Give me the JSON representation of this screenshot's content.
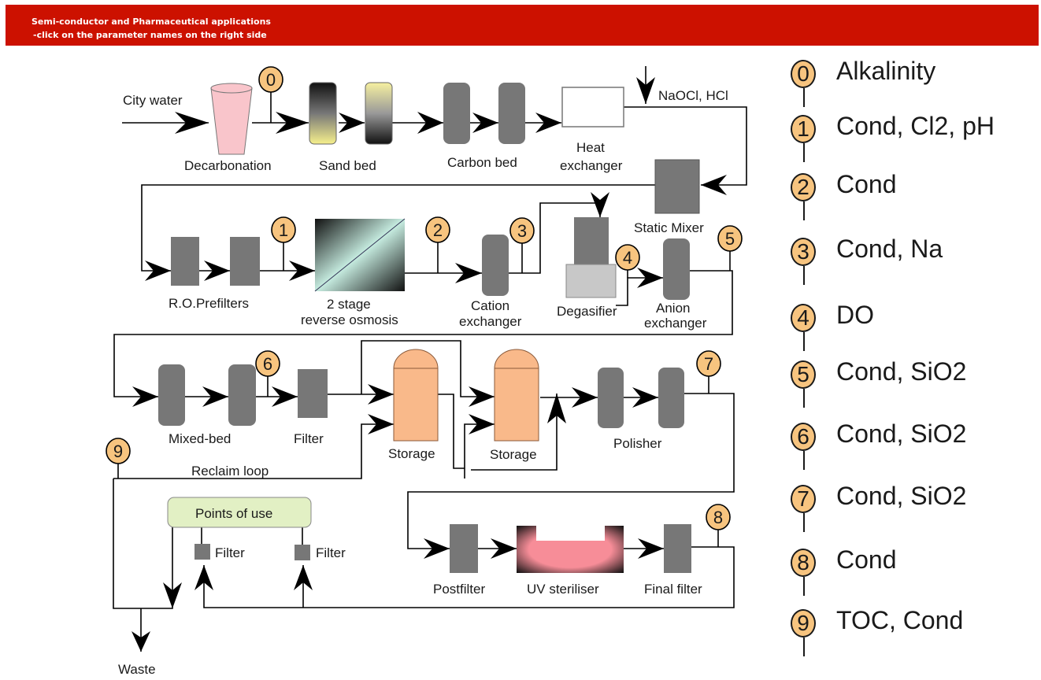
{
  "header": {
    "title": "Semi-conductor and Pharmaceutical applications",
    "subtitle": "-click on the parameter names on the right side",
    "color": "#cc1100"
  },
  "diagram": {
    "inputs": {
      "city_water": "City water",
      "chemicals": "NaOCl, HCl",
      "waste": "Waste",
      "reclaim_loop": "Reclaim loop"
    },
    "units": {
      "decarbonation": "Decarbonation",
      "sand_bed": "Sand bed",
      "carbon_bed": "Carbon bed",
      "heat_exchanger_1": "Heat",
      "heat_exchanger_2": "exchanger",
      "static_mixer": "Static Mixer",
      "ro_prefilters": "R.O.Prefilters",
      "ro_1": "2 stage",
      "ro_2": "reverse osmosis",
      "cation_1": "Cation",
      "cation_2": "exchanger",
      "degasifier": "Degasifier",
      "anion_1": "Anion",
      "anion_2": "exchanger",
      "mixed_bed": "Mixed-bed",
      "filter": "Filter",
      "storage_1": "Storage",
      "storage_2": "Storage",
      "polisher": "Polisher",
      "points_of_use": "Points of use",
      "pou_filter_1": "Filter",
      "pou_filter_2": "Filter",
      "postfilter": "Postfilter",
      "uv_steriliser": "UV steriliser",
      "final_filter": "Final filter"
    },
    "sample_points": [
      "0",
      "1",
      "2",
      "3",
      "4",
      "5",
      "6",
      "7",
      "8",
      "9"
    ],
    "colors": {
      "sample_point": "#f7c47f",
      "equipment": "#777777",
      "storage": "#f9b98a",
      "decarbonation": "#f9c5cb",
      "points_of_use": "#e2f0c4",
      "uv": "#f78d98"
    }
  },
  "legend": [
    {
      "number": "0",
      "label": "Alkalinity"
    },
    {
      "number": "1",
      "label": "Cond, Cl2, pH"
    },
    {
      "number": "2",
      "label": "Cond"
    },
    {
      "number": "3",
      "label": "Cond, Na"
    },
    {
      "number": "4",
      "label": "DO"
    },
    {
      "number": "5",
      "label": "Cond, SiO2"
    },
    {
      "number": "6",
      "label": "Cond, SiO2"
    },
    {
      "number": "7",
      "label": "Cond, SiO2"
    },
    {
      "number": "8",
      "label": "Cond"
    },
    {
      "number": "9",
      "label": "TOC, Cond"
    }
  ]
}
